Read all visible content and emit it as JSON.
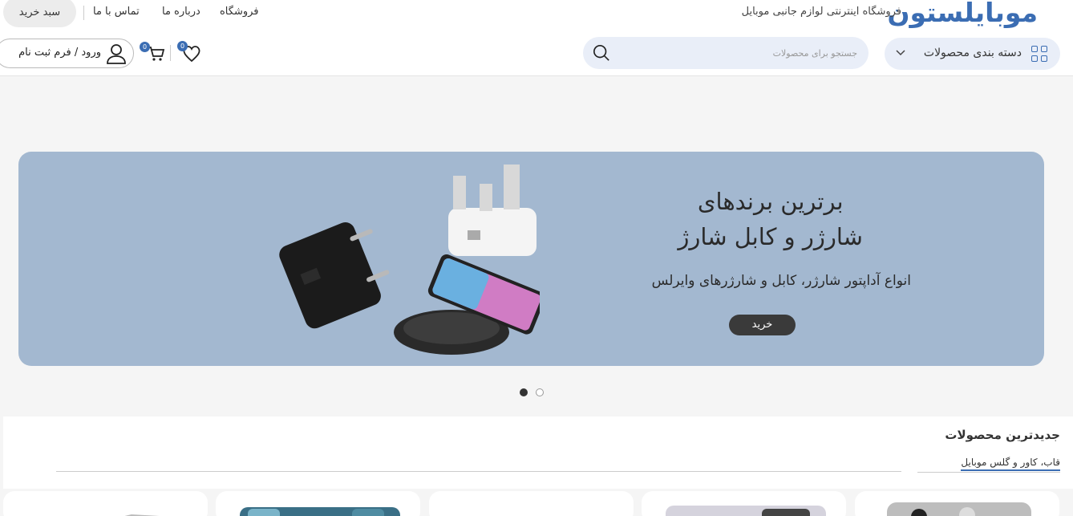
{
  "header": {
    "logo": "موبایلستون",
    "tagline": "فروشگاه اینترنتی لوازم جانبی موبایل",
    "nav": [
      "فروشگاه",
      "درباره ما",
      "تماس با ما"
    ],
    "cart_button": "سبد خرید",
    "categories_label": "دسته بندی محصولات",
    "search_placeholder": "جستجو برای محصولات",
    "login_label": "ورود / فرم ثبت نام",
    "cart_count": "0",
    "wishlist_count": "0"
  },
  "banner": {
    "title_line1": "برترین برندهای",
    "title_line2": "شارژر و کابل شارژ",
    "subtitle": "انواع آداپتور شارژر، کابل و شارژرهای وایرلس",
    "button": "خرید",
    "background_color": "#a3b8d0"
  },
  "slider": {
    "slides": 2,
    "active": 1
  },
  "section": {
    "title": "جدیدترین محصولات",
    "active_tab": "قاب، کاور و گلس موبایل"
  },
  "colors": {
    "accent": "#3b6db3"
  }
}
